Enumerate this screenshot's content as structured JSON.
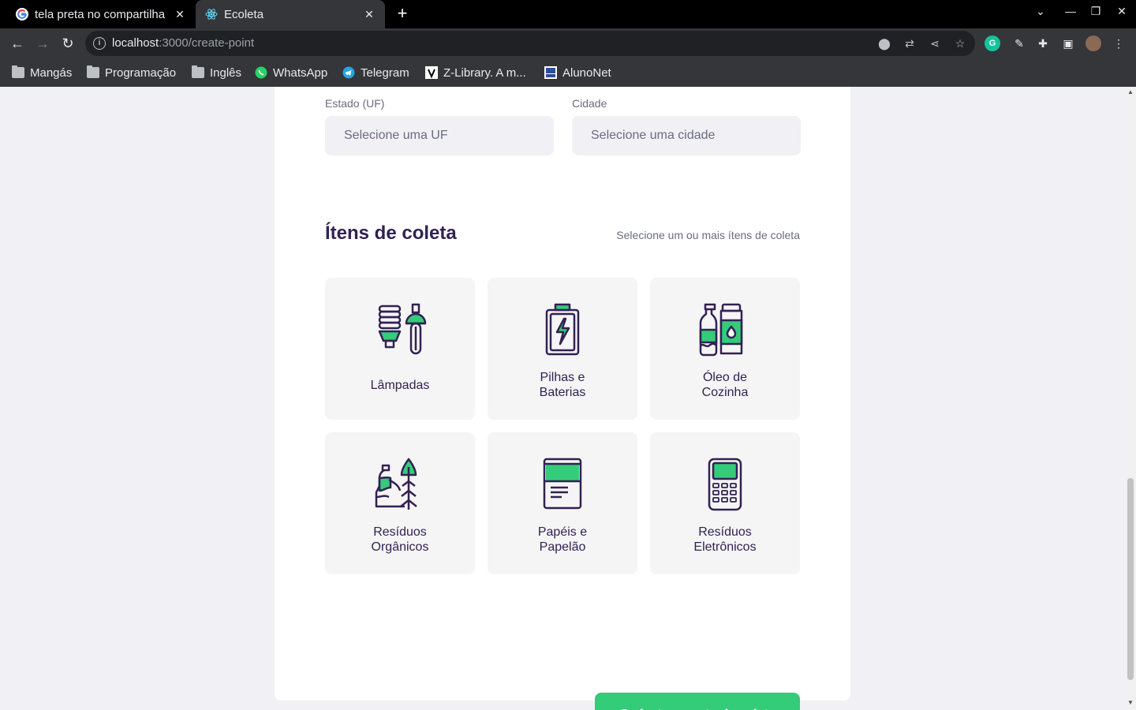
{
  "browser": {
    "tabs": [
      {
        "title": "tela preta no compartilha",
        "favicon": "google-icon",
        "active": false
      },
      {
        "title": "Ecoleta",
        "favicon": "react-icon",
        "active": true
      }
    ],
    "url_host": "localhost",
    "url_path": ":3000/create-point",
    "bookmarks": [
      {
        "label": "Mangás",
        "icon": "folder-icon"
      },
      {
        "label": "Programação",
        "icon": "folder-icon"
      },
      {
        "label": "Inglês",
        "icon": "folder-icon"
      },
      {
        "label": "WhatsApp",
        "icon": "whatsapp-icon"
      },
      {
        "label": "Telegram",
        "icon": "telegram-icon"
      },
      {
        "label": "Z-Library. A m...",
        "icon": "zlibrary-icon"
      },
      {
        "label": "AlunoNet",
        "icon": "alunonet-icon"
      }
    ]
  },
  "form": {
    "uf_label": "Estado (UF)",
    "uf_placeholder": "Selecione uma UF",
    "city_label": "Cidade",
    "city_placeholder": "Selecione uma cidade"
  },
  "items_section": {
    "title": "Ítens de coleta",
    "hint": "Selecione um ou mais ítens de coleta",
    "items": [
      {
        "label": "Lâmpadas",
        "icon": "lamp-icon"
      },
      {
        "label": "Pilhas e Baterias",
        "icon": "battery-icon"
      },
      {
        "label": "Óleo de Cozinha",
        "icon": "oil-bottles-icon"
      },
      {
        "label": "Resíduos Orgânicos",
        "icon": "organic-waste-icon"
      },
      {
        "label": "Papéis e Papelão",
        "icon": "paper-icon"
      },
      {
        "label": "Resíduos Eletrônicos",
        "icon": "electronic-device-icon"
      }
    ]
  },
  "submit_label": "Cadastrar ponto de coleta",
  "colors": {
    "accent": "#34cb79",
    "title": "#322153",
    "muted": "#6c6c80",
    "background": "#f0f0f5"
  }
}
